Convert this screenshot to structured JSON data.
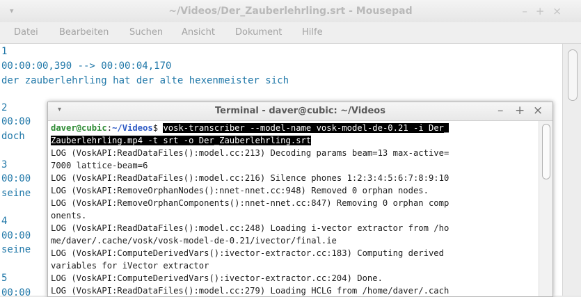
{
  "window": {
    "title": "~/Videos/Der_Zauberlehrling.srt - Mousepad",
    "menu_glyph": "▾",
    "controls": [
      "–",
      "+",
      "×"
    ]
  },
  "menubar": [
    "Datei",
    "Bearbeiten",
    "Suchen",
    "Ansicht",
    "Dokument",
    "Hilfe"
  ],
  "editor": {
    "lines": [
      "1",
      "00:00:00,390 --> 00:00:04,170",
      "der zauberlehrling hat der alte hexenmeister sich",
      "",
      "2",
      "00:00",
      "doch",
      "",
      "3",
      "00:00",
      "seine",
      "",
      "4",
      "00:00",
      "seine",
      "",
      "5",
      "00:00"
    ]
  },
  "terminal": {
    "title": "Terminal - daver@cubic: ~/Videos",
    "menu_glyph": "▾",
    "controls": [
      "–",
      "+",
      "×"
    ],
    "prompt": {
      "user_host": "daver@cubic",
      "sep": ":",
      "dir": "~/Videos",
      "symbol": "$ "
    },
    "command_line1": "vosk-transcriber --model-name vosk-model-de-0.21 -i Der_",
    "command_line2": "Zauberlehrling.mp4 -t srt -o Der_Zauberlehrling.srt",
    "output": [
      "LOG (VoskAPI:ReadDataFiles():model.cc:213) Decoding params beam=13 max-active=",
      "7000 lattice-beam=6",
      "LOG (VoskAPI:ReadDataFiles():model.cc:216) Silence phones 1:2:3:4:5:6:7:8:9:10",
      "LOG (VoskAPI:RemoveOrphanNodes():nnet-nnet.cc:948) Removed 0 orphan nodes.",
      "LOG (VoskAPI:RemoveOrphanComponents():nnet-nnet.cc:847) Removing 0 orphan comp",
      "onents.",
      "LOG (VoskAPI:ReadDataFiles():model.cc:248) Loading i-vector extractor from /ho",
      "me/daver/.cache/vosk/vosk-model-de-0.21/ivector/final.ie",
      "LOG (VoskAPI:ComputeDerivedVars():ivector-extractor.cc:183) Computing derived",
      "variables for iVector extractor",
      "LOG (VoskAPI:ComputeDerivedVars():ivector-extractor.cc:204) Done.",
      "LOG (VoskAPI:ReadDataFiles():model.cc:279) Loading HCLG from /home/daver/.cach"
    ]
  }
}
